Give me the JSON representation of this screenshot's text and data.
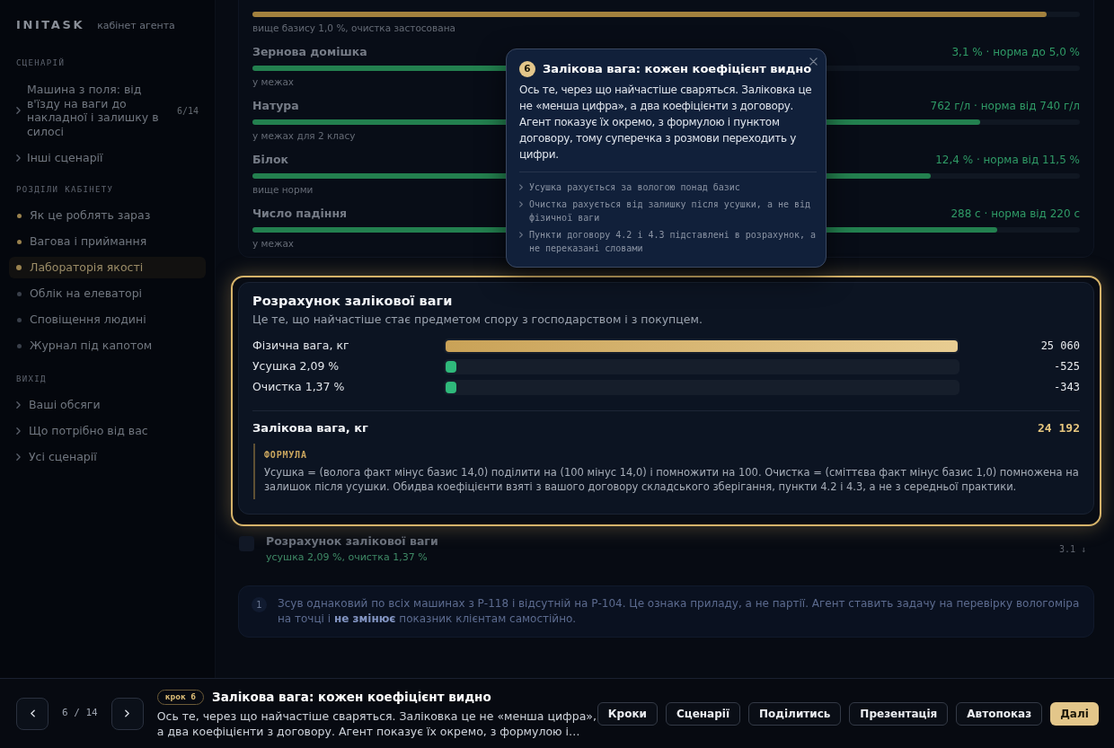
{
  "sidebar": {
    "logo": "INITASK",
    "subtitle": "кабінет агента",
    "scenario_heading": "СЦЕНАРІЙ",
    "scenario": {
      "title": "Машина з поля: від в'їзду на ваги до накладної і залишку в силосі",
      "steps": "6/14"
    },
    "other_scenarios": "Інші сценарії",
    "sections_heading": "РОЗДІЛИ КАБІНЕТУ",
    "sections": [
      {
        "label": "Як це роблять зараз",
        "selected": false,
        "visited": true
      },
      {
        "label": "Вагова і приймання",
        "selected": false,
        "visited": true
      },
      {
        "label": "Лабораторія якості",
        "selected": true,
        "visited": true
      },
      {
        "label": "Облік на елеваторі",
        "selected": false,
        "visited": false
      },
      {
        "label": "Сповіщення людині",
        "selected": false,
        "visited": false
      },
      {
        "label": "Журнал під капотом",
        "selected": false,
        "visited": false
      }
    ],
    "exit_heading": "ВИХІД",
    "exit_links": [
      "Ваші обсяги",
      "Що потрібно від вас",
      "Усі сценарії"
    ]
  },
  "quality": {
    "rows": [
      {
        "note": "вище базису 1,0 %, очистка застосована",
        "level": 0.96,
        "color": "#a3813e"
      },
      {
        "label": "Зернова домішка",
        "value": "3,1 % · норма до 5,0 %",
        "note": "у межах",
        "level": 0.62,
        "color": "#23804f"
      },
      {
        "label": "Натура",
        "value": "762 г/л · норма від 740 г/л",
        "note": "у межах для 2 класу",
        "level": 0.88,
        "color": "#23804f"
      },
      {
        "label": "Білок",
        "value": "12,4 % · норма від 11,5 %",
        "note": "вище норми",
        "level": 0.82,
        "color": "#23804f"
      },
      {
        "label": "Число падіння",
        "value": "288 с · норма від 220 с",
        "note": "у межах",
        "level": 0.9,
        "color": "#23804f"
      }
    ]
  },
  "calculation": {
    "title": "Розрахунок залікової ваги",
    "subtitle": "Це те, що найчастіше стає предметом спору з господарством і з покупцем.",
    "bars": [
      {
        "kind": "base",
        "label": "Фізична вага, кг",
        "value": "25 060",
        "level": 1
      },
      {
        "kind": "deduction",
        "label": "Усушка 2,09 %",
        "value": "-525",
        "level": 0.021
      },
      {
        "kind": "deduction",
        "label": "Очистка 1,37 %",
        "value": "-343",
        "level": 0.021
      }
    ],
    "total": {
      "label": "Залікова вага, кг",
      "value": "24 192"
    },
    "formula": {
      "heading": "ФОРМУЛА",
      "text": "Усушка = (волога факт мінус базис 14,0) поділити на (100 мінус 14,0) і помножити на 100. Очистка = (сміттєва факт мінус базис 1,0) помножена на залишок після усушки. Обидва коефіцієнти взяті з вашого договору складського зберігання, пункти 4.2 і 4.3, а не з середньої практики."
    }
  },
  "log_entry": {
    "title": "Розрахунок залікової ваги",
    "detail": "усушка 2,09 %, очистка 1,37 %",
    "tag": "3.1 ↓"
  },
  "note": {
    "number": "1",
    "text": "Зсув однаковий по всіх машинах з Р-118 і відсутній на Р-104. Це ознака приладу, а не партії. Агент ставить задачу на перевірку вологоміра на точці і **не змінює** показник клієнтам самостійно."
  },
  "tooltip": {
    "step": "6",
    "title": "Залікова вага: кожен коефіцієнт видно",
    "body": "Ось те, через що найчастіше сваряться. Заліковка це не «менша цифра», а два коефіцієнти з договору. Агент показує їх окремо, з формулою і пунктом договору, тому суперечка з розмови переходить у цифри.",
    "points": [
      "Усушка рахується за вологою понад базис",
      "Очистка рахується від залишку після усушки, а не від фізичної ваги",
      "Пункти договору 4.2 і 4.3 підставлені в розрахунок, а не переказані словами"
    ]
  },
  "footer": {
    "position": "6 / 14",
    "badge": "крок 6",
    "title": "Залікова вага: кожен коефіцієнт видно",
    "description": "Ось те, через що найчастіше сваряться. Заліковка це не «менша цифра», а два коефіцієнти з договору. Агент показує їх окремо, з формулою і…",
    "buttons": [
      {
        "label": "Кроки",
        "kind": "default"
      },
      {
        "label": "Сценарії",
        "kind": "default"
      },
      {
        "label": "Поділитись",
        "kind": "default"
      },
      {
        "label": "Презентація",
        "kind": "default"
      },
      {
        "label": "Автопоказ",
        "kind": "default"
      },
      {
        "label": "Далі",
        "kind": "primary"
      }
    ]
  }
}
